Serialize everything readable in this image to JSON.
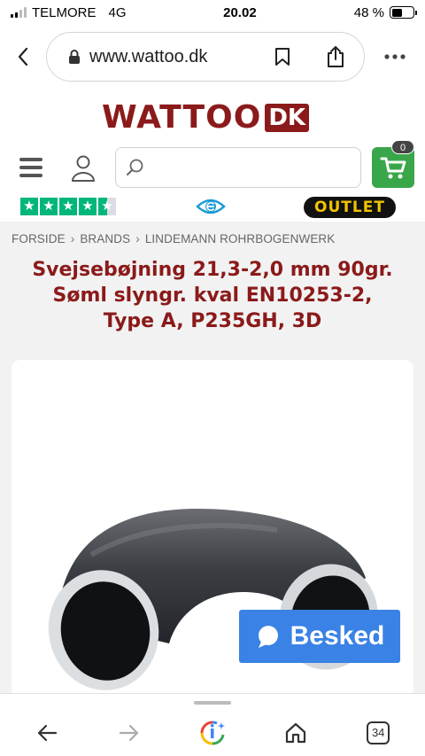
{
  "status_bar": {
    "carrier": "TELMORE",
    "network": "4G",
    "time": "20.02",
    "battery_percent": "48 %",
    "battery_level": 0.48
  },
  "browser": {
    "url": "www.wattoo.dk",
    "icons": {
      "back": "chevron-left-icon",
      "lock": "lock-icon",
      "bookmark": "bookmark-icon",
      "share": "share-icon",
      "menu": "more-horizontal-icon"
    }
  },
  "site": {
    "logo_text": "WATTOO",
    "logo_suffix": "DK",
    "search_placeholder": "",
    "cart_count": "0",
    "rating_stars": 4.5,
    "outlet_label": "OUTLET",
    "brand_color": "#8b1a1a",
    "cart_color": "#3aa64a",
    "trust_color": "#00b67a"
  },
  "breadcrumb": [
    "FORSIDE",
    "BRANDS",
    "LINDEMANN ROHRBOGENWERK"
  ],
  "product": {
    "title_lines": [
      "Svejsebøjning 21,3-2,0 mm 90gr.",
      "Søml slyngr. kval EN10253-2,",
      "Type A, P235GH, 3D"
    ]
  },
  "chat": {
    "label": "Besked",
    "color": "#3a82e5"
  },
  "bottom_nav": {
    "tabs_count": "34",
    "icons": [
      "arrow-left-icon",
      "arrow-right-icon",
      "google-lens-icon",
      "home-icon",
      "tabs-icon"
    ]
  }
}
